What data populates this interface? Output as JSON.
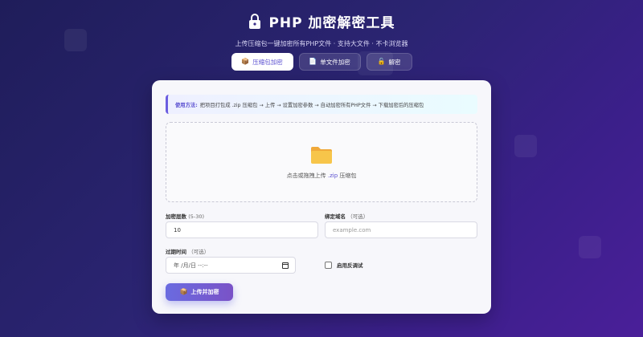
{
  "header": {
    "title": "PHP 加密解密工具",
    "subtitle": "上传压缩包一键加密所有PHP文件 · 支持大文件 · 不卡浏览器"
  },
  "tabs": [
    {
      "label": "压缩包加密",
      "icon": "package-icon",
      "active": true
    },
    {
      "label": "单文件加密",
      "icon": "document-icon",
      "active": false
    },
    {
      "label": "解密",
      "icon": "unlock-icon",
      "active": false
    }
  ],
  "usage": {
    "label": "使用方法:",
    "text": "把项目打包成 .zip 压缩包 → 上传 → 设置加密参数 → 自动加密所有PHP文件 → 下载加密后的压缩包"
  },
  "dropzone": {
    "icon": "folder-icon",
    "text_prefix": "点击或拖拽上传",
    "ext": ".zip",
    "text_suffix": "压缩包"
  },
  "form": {
    "layers_label": "加密层数",
    "layers_hint": "(5-30)",
    "layers_value": "10",
    "domain_label": "绑定域名",
    "domain_hint": "（可选）",
    "domain_placeholder": "example.com",
    "expire_label": "过期时间",
    "expire_hint": "（可选）",
    "expire_placeholder": "年 /月/日 --:--",
    "debug_label": "启用反调试",
    "debug_checked": false
  },
  "submit": {
    "label": "上传并加密",
    "icon": "package-icon"
  },
  "colors": {
    "accent": "#5a4fd0",
    "button_gradient_start": "#6a6be0",
    "button_gradient_end": "#7a52c7"
  }
}
